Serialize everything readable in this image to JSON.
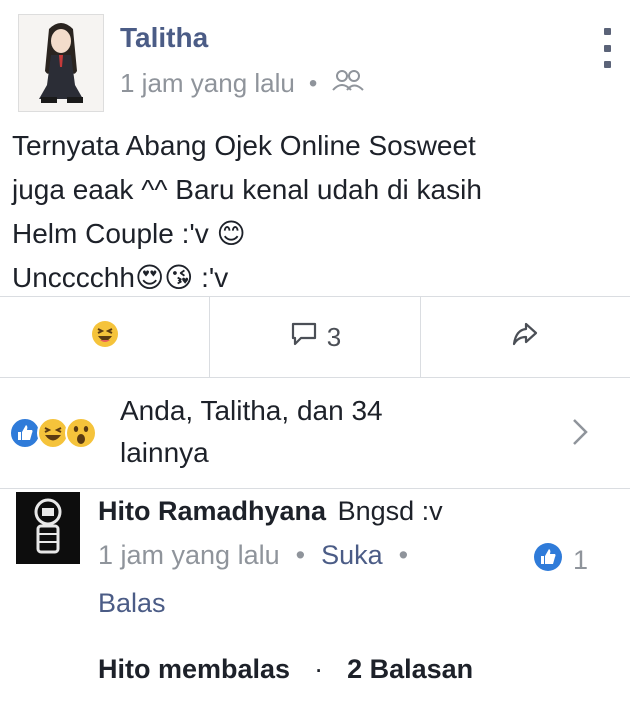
{
  "post": {
    "author": "Talitha",
    "time": "1 jam yang lalu",
    "meta_separator": "•",
    "privacy_icon": "friends-icon",
    "lines": [
      "Ternyata Abang Ojek Online Sosweet",
      "juga eaak ^^ Baru kenal udah di kasih",
      "Helm Couple :'v 😊",
      "Uncccchh😍😘 :'v"
    ]
  },
  "actions": {
    "reaction_icon": "haha-emoji-icon",
    "comment_count": "3",
    "share_icon": "share-icon"
  },
  "reactions": {
    "text": "Anda, Talitha, dan 34 lainnya",
    "line1": "Anda, Talitha, dan 34",
    "line2": "lainnya",
    "icons": [
      "like-icon",
      "haha-icon",
      "wow-icon"
    ]
  },
  "comment": {
    "author": "Hito Ramadhyana",
    "text": "Bngsd :v",
    "time": "1 jam yang lalu",
    "separator": "•",
    "like_label": "Suka",
    "reply_label": "Balas",
    "like_count": "1"
  },
  "replies": {
    "author_replied": "Hito membalas",
    "separator": "·",
    "count_label": "2 Balasan"
  },
  "colors": {
    "name_blue": "#4b5c86",
    "meta_gray": "#8f949b",
    "like_blue": "#2f7bd9",
    "emoji_yellow": "#f5c33b"
  }
}
